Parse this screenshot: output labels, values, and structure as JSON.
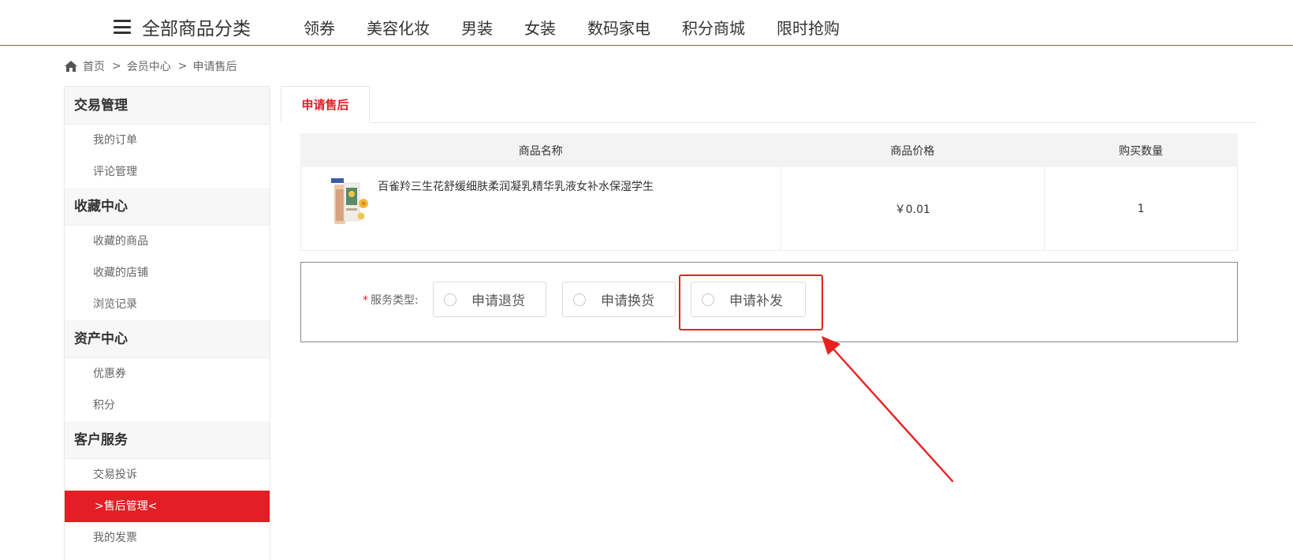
{
  "topnav": {
    "category_label": "全部商品分类",
    "items": [
      "领券",
      "美容化妆",
      "男装",
      "女装",
      "数码家电",
      "积分商城",
      "限时抢购"
    ]
  },
  "breadcrumb": {
    "home": "首页",
    "sep": ">",
    "member": "会员中心",
    "current": "申请售后"
  },
  "sidebar": {
    "groups": [
      {
        "title": "交易管理",
        "items": [
          "我的订单",
          "评论管理"
        ]
      },
      {
        "title": "收藏中心",
        "items": [
          "收藏的商品",
          "收藏的店铺",
          "浏览记录"
        ]
      },
      {
        "title": "资产中心",
        "items": [
          "优惠券",
          "积分"
        ]
      },
      {
        "title": "客户服务",
        "items": [
          "交易投诉",
          ">售后管理<",
          "我的发票"
        ]
      }
    ],
    "active_item": ">售后管理<"
  },
  "main": {
    "tab_label": "申请售后",
    "table": {
      "headers": [
        "商品名称",
        "商品价格",
        "购买数量"
      ],
      "rows": [
        {
          "name": "百雀羚三生花舒缓细肤柔润凝乳精华乳液女补水保湿学生",
          "price": "￥0.01",
          "qty": "1"
        }
      ]
    },
    "service": {
      "required_mark": "*",
      "label": "服务类型:",
      "options": [
        "申请退货",
        "申请换货",
        "申请补发"
      ]
    }
  },
  "colors": {
    "accent": "#e31e24",
    "annotation": "#e8201f"
  }
}
